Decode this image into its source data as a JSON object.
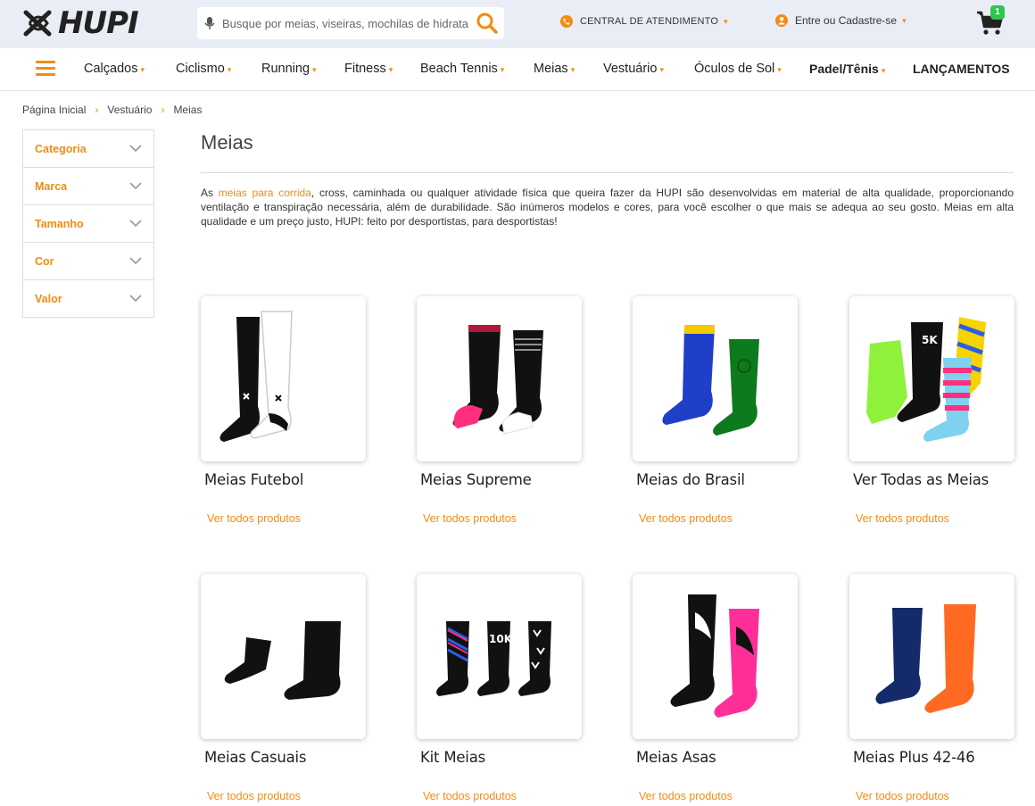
{
  "header": {
    "logo_text": "HUPI",
    "search_placeholder": "Busque por meias, viseiras, mochilas de hidratação...",
    "central_label": "CENTRAL DE ATENDIMENTO",
    "account_label": "Entre ou Cadastre-se",
    "cart_count": "1"
  },
  "nav": {
    "items": [
      {
        "label": "Calçados"
      },
      {
        "label": "Ciclismo"
      },
      {
        "label": "Running"
      },
      {
        "label": "Fitness"
      },
      {
        "label": "Beach Tennis"
      },
      {
        "label": "Meias"
      },
      {
        "label": "Vestuário"
      },
      {
        "label": "Óculos de Sol"
      },
      {
        "label": "Padel/Tênis"
      },
      {
        "label": "LANÇAMENTOS"
      }
    ]
  },
  "breadcrumb": [
    "Página Inicial",
    "Vestuário",
    "Meias"
  ],
  "filters": [
    "Categoria",
    "Marca",
    "Tamanho",
    "Cor",
    "Valor"
  ],
  "page": {
    "title": "Meias",
    "desc_prefix": "As ",
    "desc_link": "meias para corrida",
    "desc_rest": ", cross, caminhada ou qualquer atividade física que queira fazer da HUPI são desenvolvidas em material de alta qualidade, proporcionando ventilação e transpiração necessária, além de durabilidade. São inúmeros modelos e cores, para você escolher o que mais se adequa ao seu gosto. Meias em alta qualidade e um preço justo, HUPI: feito por desportistas, para desportistas!"
  },
  "categories": [
    {
      "name": "Meias Futebol",
      "link": "Ver todos produtos"
    },
    {
      "name": "Meias Supreme",
      "link": "Ver todos produtos"
    },
    {
      "name": "Meias do Brasil",
      "link": "Ver todos produtos"
    },
    {
      "name": "Ver Todas as Meias",
      "link": "Ver todos produtos"
    },
    {
      "name": "Meias Casuais",
      "link": "Ver todos produtos"
    },
    {
      "name": "Kit Meias",
      "link": "Ver todos produtos"
    },
    {
      "name": "Meias Asas",
      "link": "Ver todos produtos"
    },
    {
      "name": "Meias Plus 42-46",
      "link": "Ver todos produtos"
    }
  ],
  "colors": {
    "accent": "#f28c13",
    "topbar": "#e9edf5",
    "badge": "#2ec44f"
  }
}
